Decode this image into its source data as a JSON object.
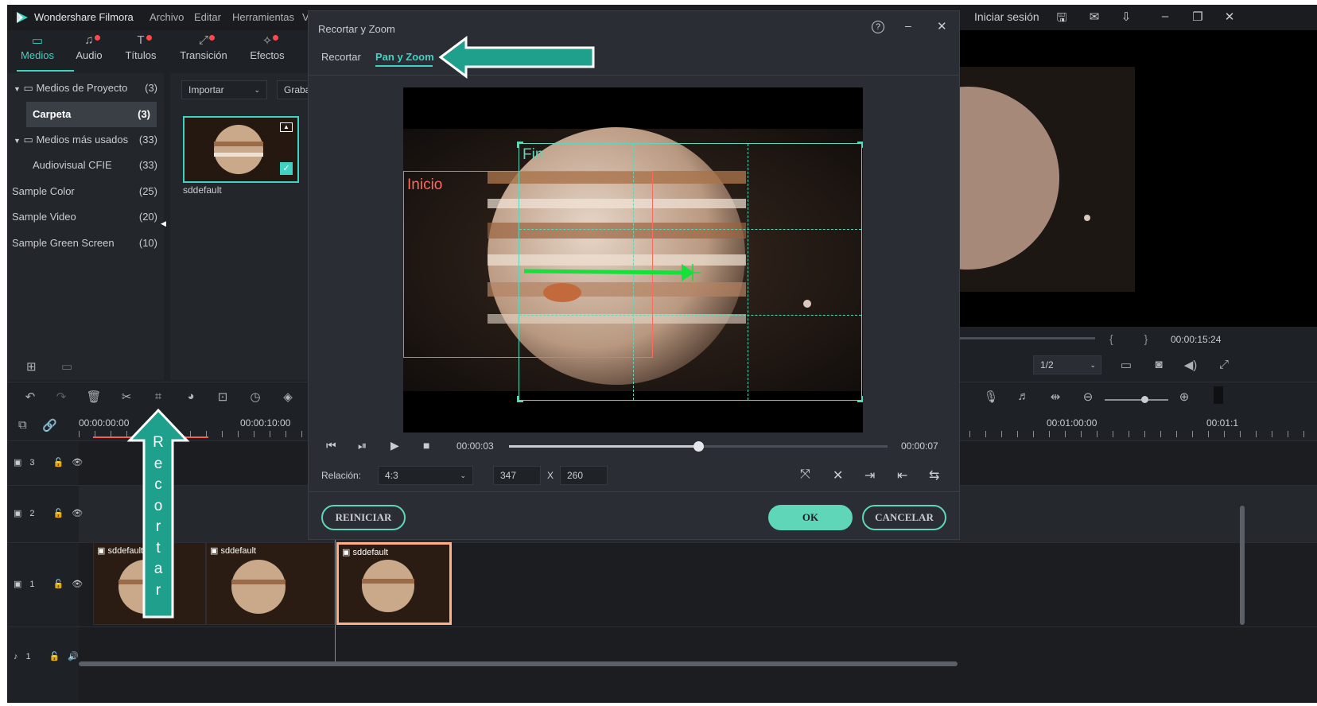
{
  "app": {
    "name": "Wondershare Filmora",
    "menus": [
      "Archivo",
      "Editar",
      "Herramientas",
      "V"
    ],
    "signin": "Iniciar sesión"
  },
  "tabs": [
    {
      "label": "Medios",
      "icon": "folder-icon"
    },
    {
      "label": "Audio",
      "icon": "music-note-icon"
    },
    {
      "label": "Títulos",
      "icon": "text-icon"
    },
    {
      "label": "Transición",
      "icon": "transition-icon"
    },
    {
      "label": "Efectos",
      "icon": "effects-icon"
    }
  ],
  "library": {
    "items": [
      {
        "label": "Medios de Proyecto",
        "count": "(3)"
      },
      {
        "label": "Carpeta",
        "count": "(3)"
      },
      {
        "label": "Medios más usados",
        "count": "(33)"
      },
      {
        "label": "Audiovisual CFIE",
        "count": "(33)"
      },
      {
        "label": "Sample Color",
        "count": "(25)"
      },
      {
        "label": "Sample Video",
        "count": "(20)"
      },
      {
        "label": "Sample Green Screen",
        "count": "(10)"
      }
    ],
    "import_label": "Importar",
    "record_label": "Graba",
    "media_name": "sddefault"
  },
  "preview": {
    "time": "00:00:15:24",
    "ratio": "1/2",
    "brackets": "{          }"
  },
  "timeline": {
    "t0": "00:00:00:00",
    "t1": "00:00:10:00",
    "t2": "00:01:00:00",
    "t3": "00:01:1",
    "clip_name": "sddefault",
    "tracks": [
      "3",
      "2",
      "1",
      "1"
    ]
  },
  "annotation": {
    "vertical_text": [
      "R",
      "e",
      "c",
      "o",
      "r",
      "t",
      "a",
      "r"
    ]
  },
  "dialog": {
    "title": "Recortar y Zoom",
    "tab_crop": "Recortar",
    "tab_pan": "Pan y Zoom",
    "label_start": "Inicio",
    "label_end": "Fin",
    "time_current": "00:00:03",
    "time_total": "00:00:07",
    "progress": 0.5,
    "ratio_label": "Relación:",
    "ratio_value": "4:3",
    "width": "347",
    "x": "X",
    "height": "260",
    "reset": "REINICIAR",
    "ok": "OK",
    "cancel": "CANCELAR"
  },
  "colors": {
    "accent": "#3fd3c3",
    "start": "#ff6a5c",
    "end": "#5fd6b8",
    "arrow": "#1fa08c",
    "green": "#16e03a"
  }
}
